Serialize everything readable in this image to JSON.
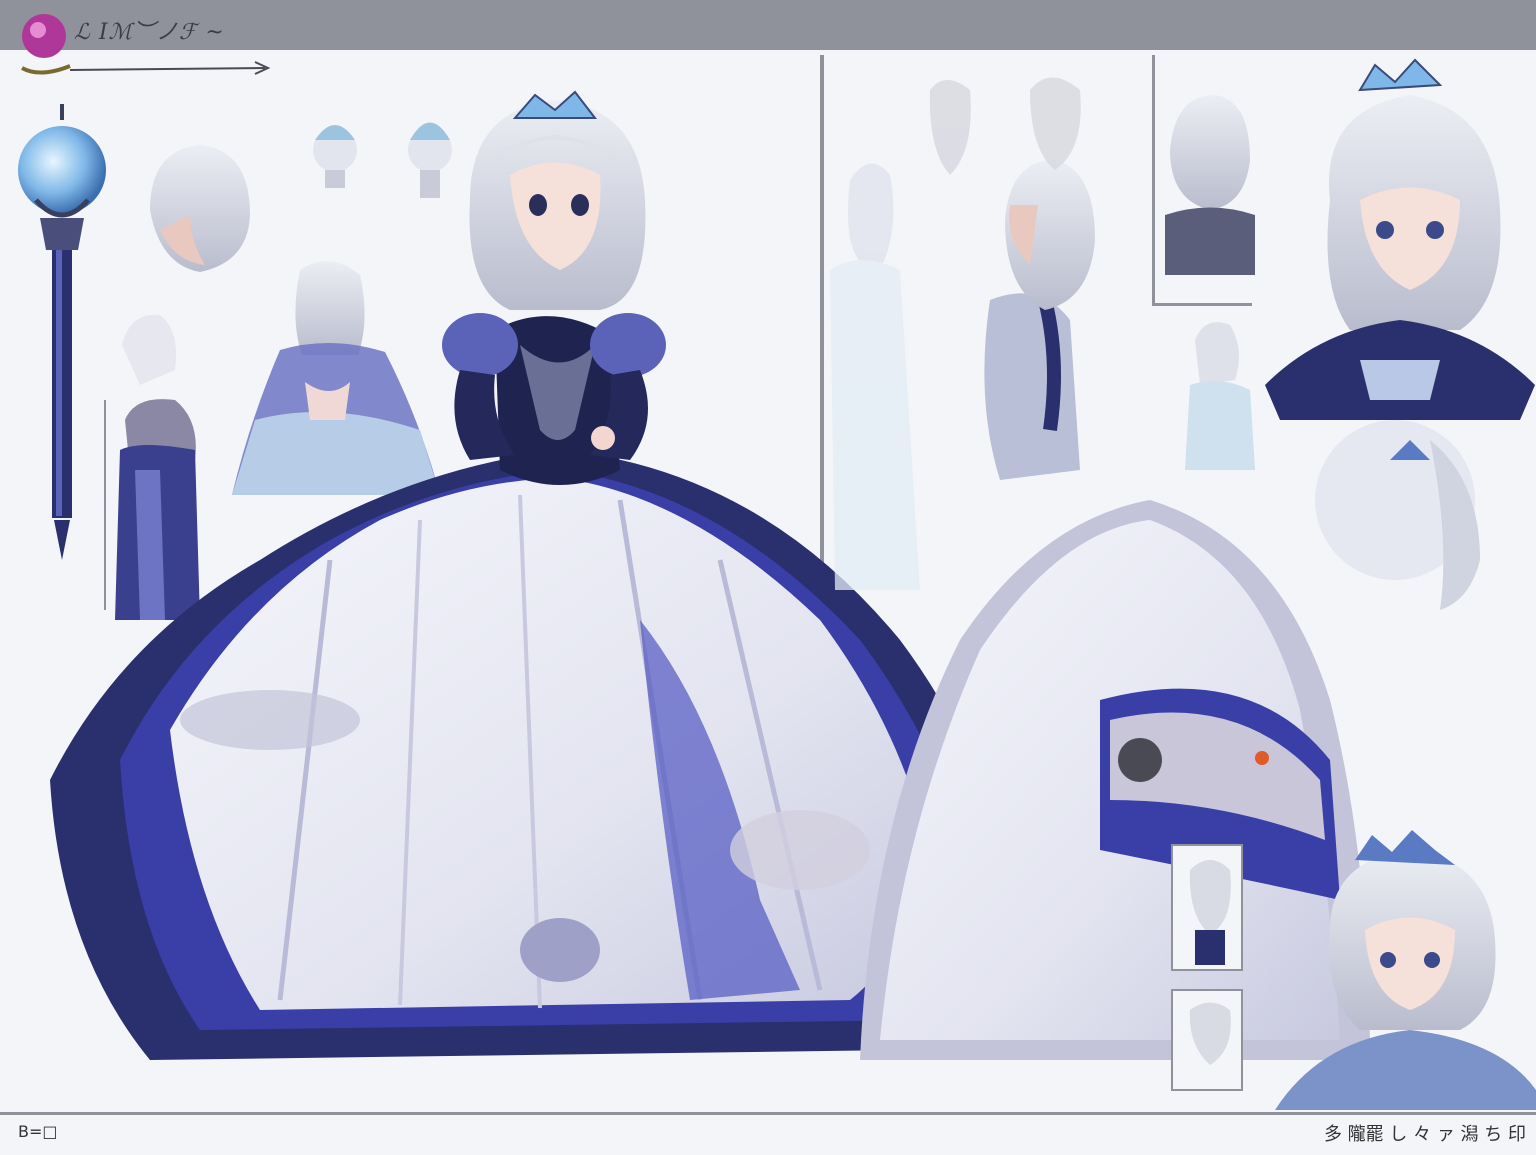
{
  "sheet": {
    "corner_label": "ℒ Iℳ︶ノℱ ~",
    "footer_left": "B=□",
    "footer_right": "多 隴罷 し 々 ァ 潟 ち 印"
  },
  "colors": {
    "navy": "#2a2f6e",
    "royal_blue": "#3a3fa8",
    "silver_hair": "#dcdde6",
    "skirt_white": "#eef0f6",
    "shadow_lavender": "#b9bad8",
    "crystal_blue": "#7fb8e8",
    "gem_magenta": "#b0379a"
  }
}
